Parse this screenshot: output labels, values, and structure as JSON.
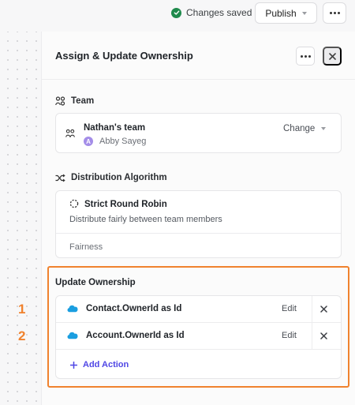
{
  "topbar": {
    "status": "Changes saved",
    "publish_label": "Publish",
    "status_color": "#1f8a4c"
  },
  "panel": {
    "title": "Assign & Update Ownership"
  },
  "team_section": {
    "label": "Team",
    "team_name": "Nathan's team",
    "member_initial": "A",
    "member_name": "Abby Sayeg",
    "change_label": "Change"
  },
  "algorithm_section": {
    "label": "Distribution Algorithm",
    "name": "Strict Round Robin",
    "description": "Distribute fairly between team members",
    "fairness_label": "Fairness"
  },
  "update_section": {
    "title": "Update Ownership",
    "highlight_color": "#f0822e",
    "actions": [
      {
        "number": "1",
        "label": "Contact.OwnerId as Id",
        "edit": "Edit",
        "icon": "salesforce-cloud-icon"
      },
      {
        "number": "2",
        "label": "Account.OwnerId as Id",
        "edit": "Edit",
        "icon": "salesforce-cloud-icon"
      }
    ],
    "add_action_label": "Add Action",
    "accent_color": "#4f46e5"
  }
}
